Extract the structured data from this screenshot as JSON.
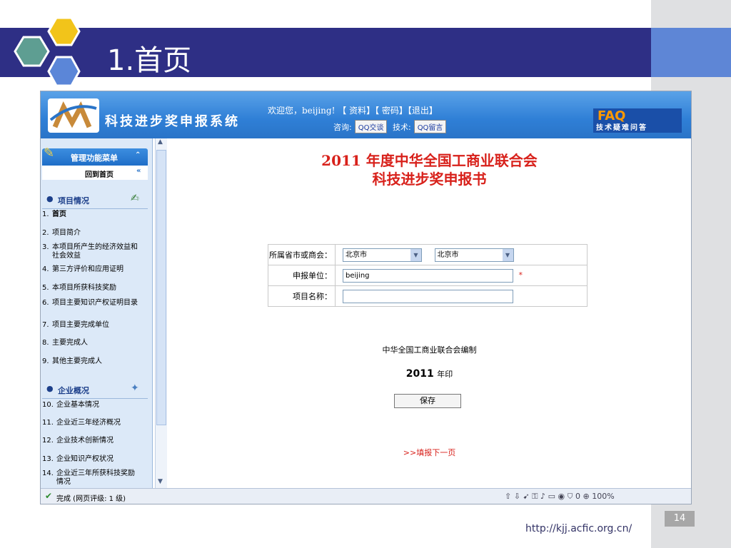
{
  "slide": {
    "title": "1.首页",
    "footer_url": "http://kjj.acfic.org.cn/",
    "page_number": "14",
    "colors": {
      "band": "#2e2f85",
      "accent": "#5e86d6"
    }
  },
  "app": {
    "title": "科技进步奖申报系统",
    "welcome": "欢迎您，beijing!",
    "links": [
      "【 资料】",
      "【 密码】",
      "【退出】"
    ],
    "consult_label": "咨询:",
    "consult_button": "QQ交谈",
    "tech_label": "技术:",
    "tech_button": "QQ留言",
    "faq_big": "FAQ",
    "faq_sub": "技术疑难问答"
  },
  "sidebar": {
    "menu_title": "管理功能菜单",
    "home_link": "回到首页",
    "section1": "项目情况",
    "items1": [
      {
        "num": "1.",
        "label": "首页"
      },
      {
        "num": "2.",
        "label": "项目简介"
      },
      {
        "num": "3.",
        "label": "本项目所产生的经济效益和社会效益"
      },
      {
        "num": "4.",
        "label": "第三方评价和应用证明"
      },
      {
        "num": "5.",
        "label": "本项目所获科技奖励"
      },
      {
        "num": "6.",
        "label": "项目主要知识产权证明目录"
      },
      {
        "num": "7.",
        "label": "项目主要完成单位"
      },
      {
        "num": "8.",
        "label": "主要完成人"
      },
      {
        "num": "9.",
        "label": "其他主要完成人"
      }
    ],
    "section2": "企业概况",
    "items2": [
      {
        "num": "10.",
        "label": "企业基本情况"
      },
      {
        "num": "11.",
        "label": "企业近三年经济概况"
      },
      {
        "num": "12.",
        "label": "企业技术创新情况"
      },
      {
        "num": "13.",
        "label": "企业知识产权状况"
      },
      {
        "num": "14.",
        "label": "企业近三年所获科技奖励情况"
      }
    ]
  },
  "main": {
    "title_line1": "2011 年度中华全国工商业联合会",
    "title_line2": "科技进步奖申报书",
    "form": {
      "province_label": "所属省市或商会：",
      "province_value": "北京市",
      "city_value": "北京市",
      "unit_label": "申报单位：",
      "unit_value": "beijing",
      "required_mark": "*",
      "project_label": "项目名称：",
      "project_value": ""
    },
    "compiler": "中华全国工商业联合会编制",
    "year": "2011",
    "year_suffix": "年印",
    "save_button": "保存",
    "next_link": ">>填报下一页"
  },
  "statusbar": {
    "text": "完成 (网页评级: 1 级)",
    "zoom": "100%",
    "count": "0"
  }
}
